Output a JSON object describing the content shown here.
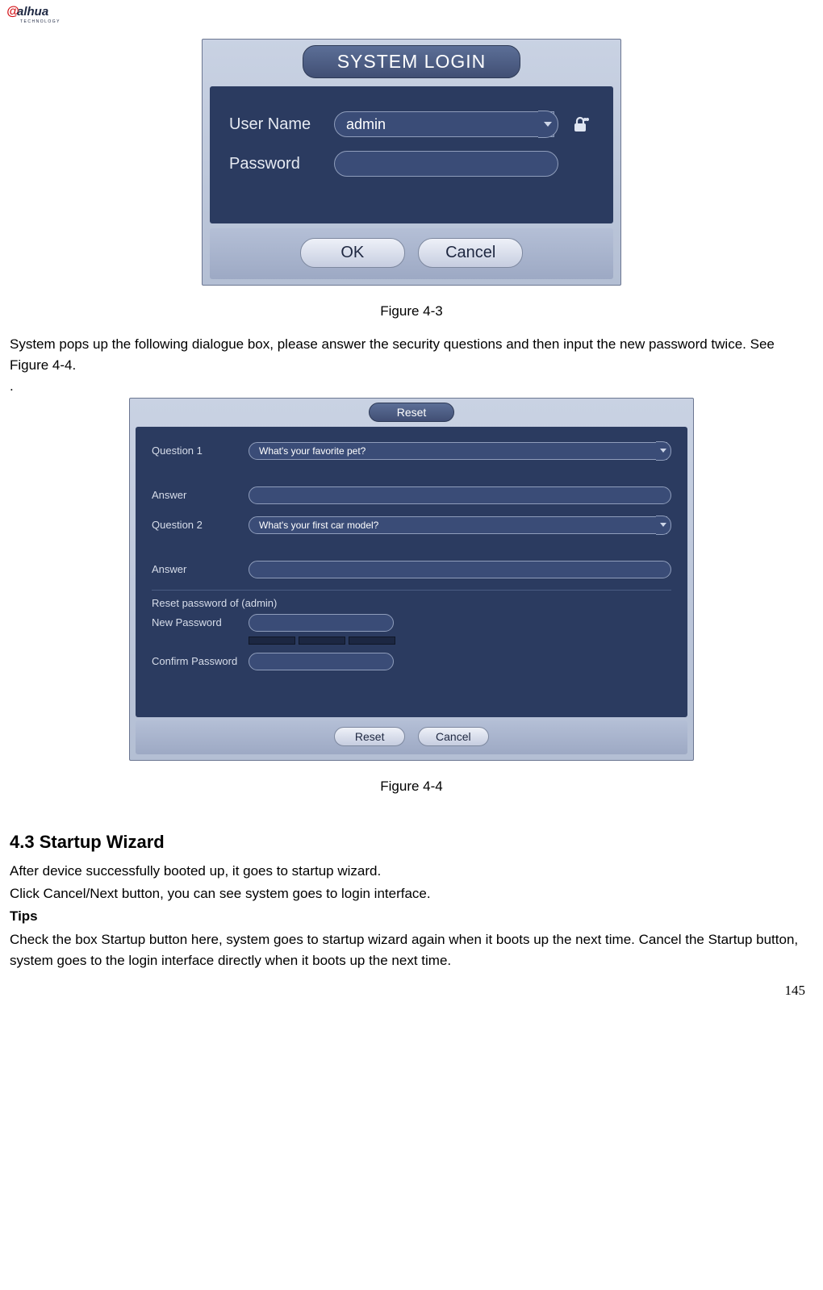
{
  "logo": {
    "brand": "alhua",
    "tagline": "TECHNOLOGY"
  },
  "login_dialog": {
    "title": "SYSTEM LOGIN",
    "username_label": "User Name",
    "username_value": "admin",
    "password_label": "Password",
    "password_value": "",
    "ok_label": "OK",
    "cancel_label": "Cancel"
  },
  "caption_1": "Figure 4-3",
  "para_1": "System pops up the following dialogue box, please answer the security questions and then input the new password twice. See Figure 4-4.",
  "dot_line": ".",
  "reset_dialog": {
    "title": "Reset",
    "q1_label": "Question 1",
    "q1_value": "What's your favorite pet?",
    "a1_label": "Answer",
    "a1_value": "",
    "q2_label": "Question 2",
    "q2_value": "What's your first car model?",
    "a2_label": "Answer",
    "a2_value": "",
    "section_label": "Reset password of (admin)",
    "newpw_label": "New Password",
    "confirm_label": "Confirm Password",
    "reset_label": "Reset",
    "cancel_label": "Cancel"
  },
  "caption_2": "Figure 4-4",
  "section_heading": "4.3  Startup Wizard",
  "para_2": "After device successfully booted up, it goes to startup wizard.",
  "para_3": "Click Cancel/Next button, you can see system goes to login interface.",
  "tips_label": "Tips",
  "para_4": "Check the box Startup button here, system goes to startup wizard again when it boots up the next time. Cancel the Startup button, system goes to the login interface directly when it boots up the next time.",
  "page_number": "145"
}
